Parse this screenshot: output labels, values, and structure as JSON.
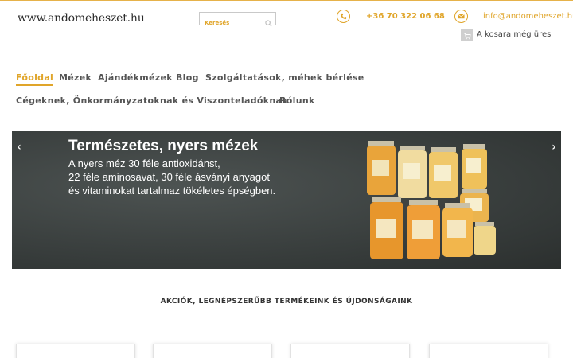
{
  "header": {
    "logo_text": "www.andomeheszet.hu",
    "search_placeholder": "Keresés",
    "phone": "+36 70 322 06 68",
    "email": "info@andomeheszet.hu",
    "cart_text": "A kosara még üres"
  },
  "nav": {
    "items": [
      {
        "label": "Főoldal",
        "active": true
      },
      {
        "label": "Mézek"
      },
      {
        "label": "Ajándékmézek"
      },
      {
        "label": "Blog"
      },
      {
        "label": "Szolgáltatások, méhek bérlése"
      },
      {
        "label": "Cégeknek, Önkormányzatoknak és Viszonteladóknak"
      },
      {
        "label": "Rólunk"
      }
    ]
  },
  "slider": {
    "title": "Természetes, nyers mézek",
    "line1": "A nyers méz 30 féle antioxidánst,",
    "line2": "22 féle aminosavat, 30 féle ásványi anyagot",
    "line3": "és vitaminokat tartalmaz tökéletes épségben.",
    "prev": "‹",
    "next": "›"
  },
  "section": {
    "title": "AKCIÓK, LEGNÉPSZERŰBB TERMÉKEINK ÉS ÚJDONSÁGAINK"
  },
  "colors": {
    "accent": "#e0a52a",
    "slider_bg": "#3a3f3e"
  }
}
